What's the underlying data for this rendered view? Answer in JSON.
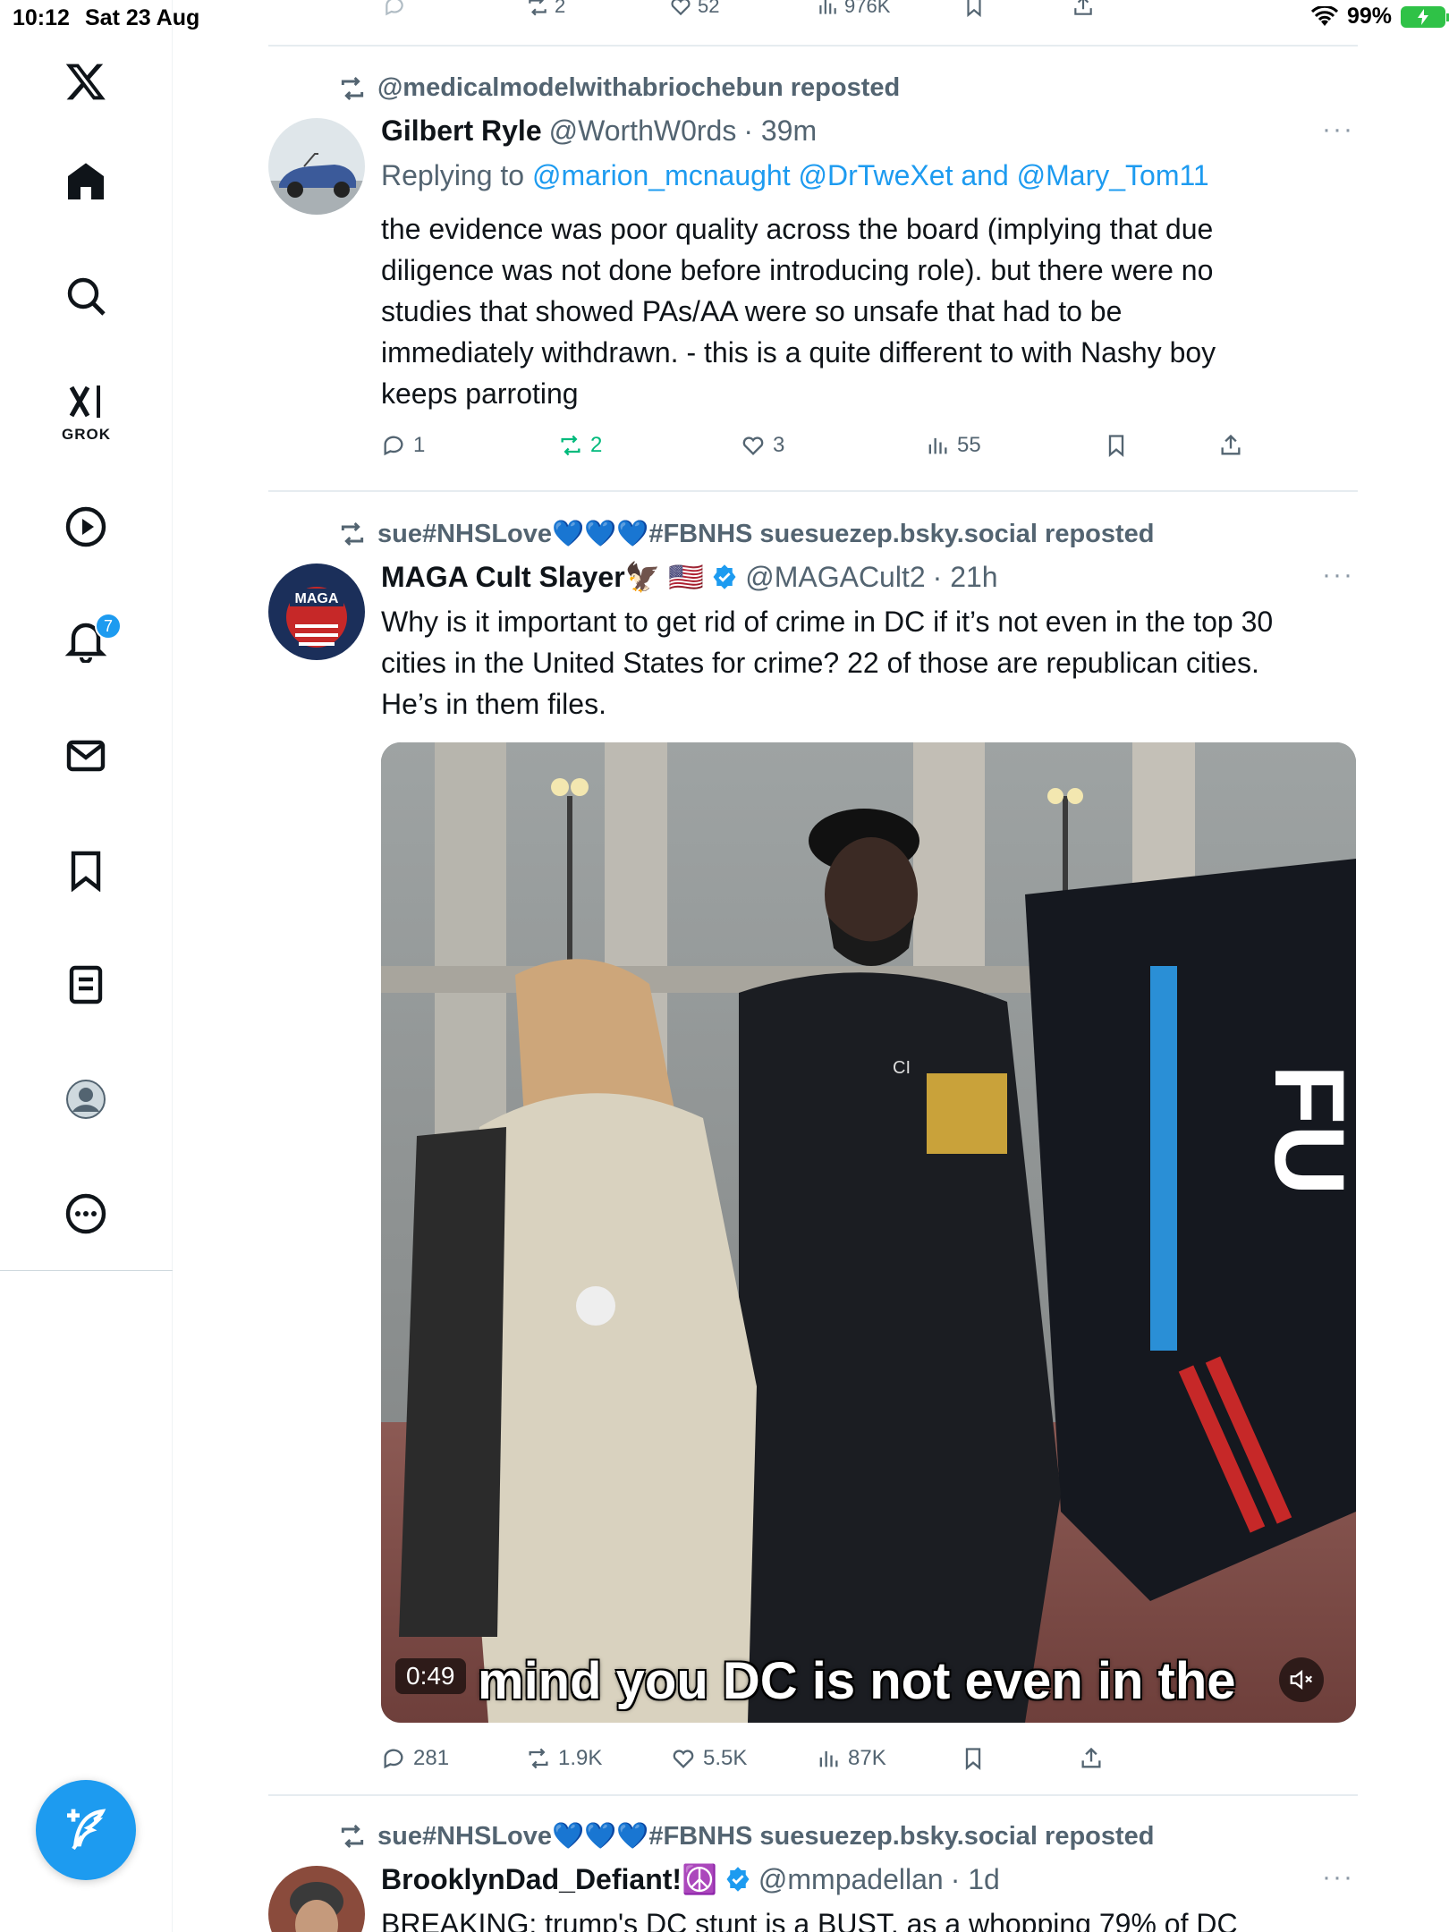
{
  "status_bar": {
    "time": "10:12",
    "date": "Sat 23 Aug",
    "battery": "99%"
  },
  "sidebar": {
    "grok_label": "GROK",
    "notification_count": "7"
  },
  "top_actions": {
    "reposts": "2",
    "likes": "52",
    "views": "976K"
  },
  "posts": [
    {
      "reposted_by": "@medicalmodelwithabriochebun reposted",
      "name": "Gilbert Ryle",
      "handle": "@WorthW0rds",
      "time": "· 39m",
      "replying_prefix": "Replying to",
      "replying_mentions": "@marion_mcnaught @DrTweXet and @Mary_Tom11",
      "text": "the evidence was poor quality across the board (implying that due\ndiligence was not done before introducing role). but there were no\nstudies that showed PAs/AA were so unsafe that had to be\nimmediately withdrawn.  - this is a quite different to with Nashy boy\nkeeps parroting",
      "replies": "1",
      "reposts": "2",
      "likes": "3",
      "views": "55"
    },
    {
      "reposted_by": "sue#NHSLove💙💙💙#FBNHS suesuezep.bsky.social reposted",
      "name": "MAGA Cult Slayer🦅 🇺🇸",
      "handle": "@MAGACult2",
      "time": "· 21h",
      "text": "Why is it important to get rid of crime in DC if it’s not even in the top 30\ncities in the United States for crime? 22 of those are republican cities.\nHe’s in them files.",
      "video_duration": "0:49",
      "video_caption": "mind you DC is not even in the",
      "replies": "281",
      "reposts": "1.9K",
      "likes": "5.5K",
      "views": "87K",
      "video_sign_text": "CI",
      "avatar_text": "MAGA"
    },
    {
      "reposted_by": "sue#NHSLove💙💙💙#FBNHS suesuezep.bsky.social reposted",
      "name": "BrooklynDad_Defiant!☮️",
      "handle": "@mmpadellan",
      "time": "· 1d",
      "text": "BREAKING: trump's DC stunt is a BUST, as a whopping 79% of DC"
    }
  ],
  "colors": {
    "accent": "#1d9bf0",
    "repost_green": "#00ba7c",
    "muted": "#536471"
  }
}
